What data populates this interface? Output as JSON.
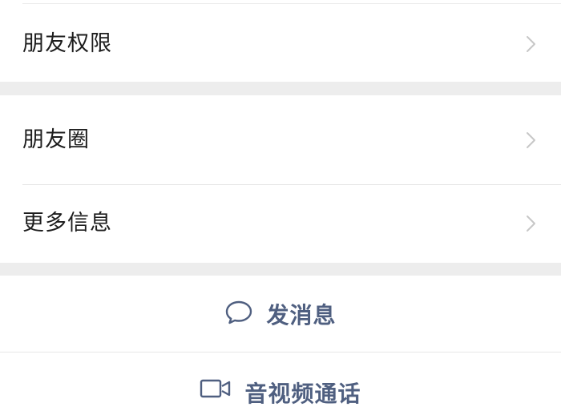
{
  "settings": {
    "items": [
      {
        "label": "朋友权限",
        "chevron_icon": "chevron-right-icon"
      },
      {
        "label": "朋友圈",
        "chevron_icon": "chevron-right-icon"
      },
      {
        "label": "更多信息",
        "chevron_icon": "chevron-right-icon"
      }
    ]
  },
  "actions": {
    "send_message": {
      "label": "发消息",
      "icon": "chat-bubble-icon"
    },
    "av_call": {
      "label": "音视频通话",
      "icon": "video-camera-icon"
    }
  },
  "colors": {
    "background": "#ffffff",
    "section_gap": "#ededed",
    "divider": "#e5e5e5",
    "action_text": "#4f5f80",
    "chevron": "#c7c7c7"
  }
}
